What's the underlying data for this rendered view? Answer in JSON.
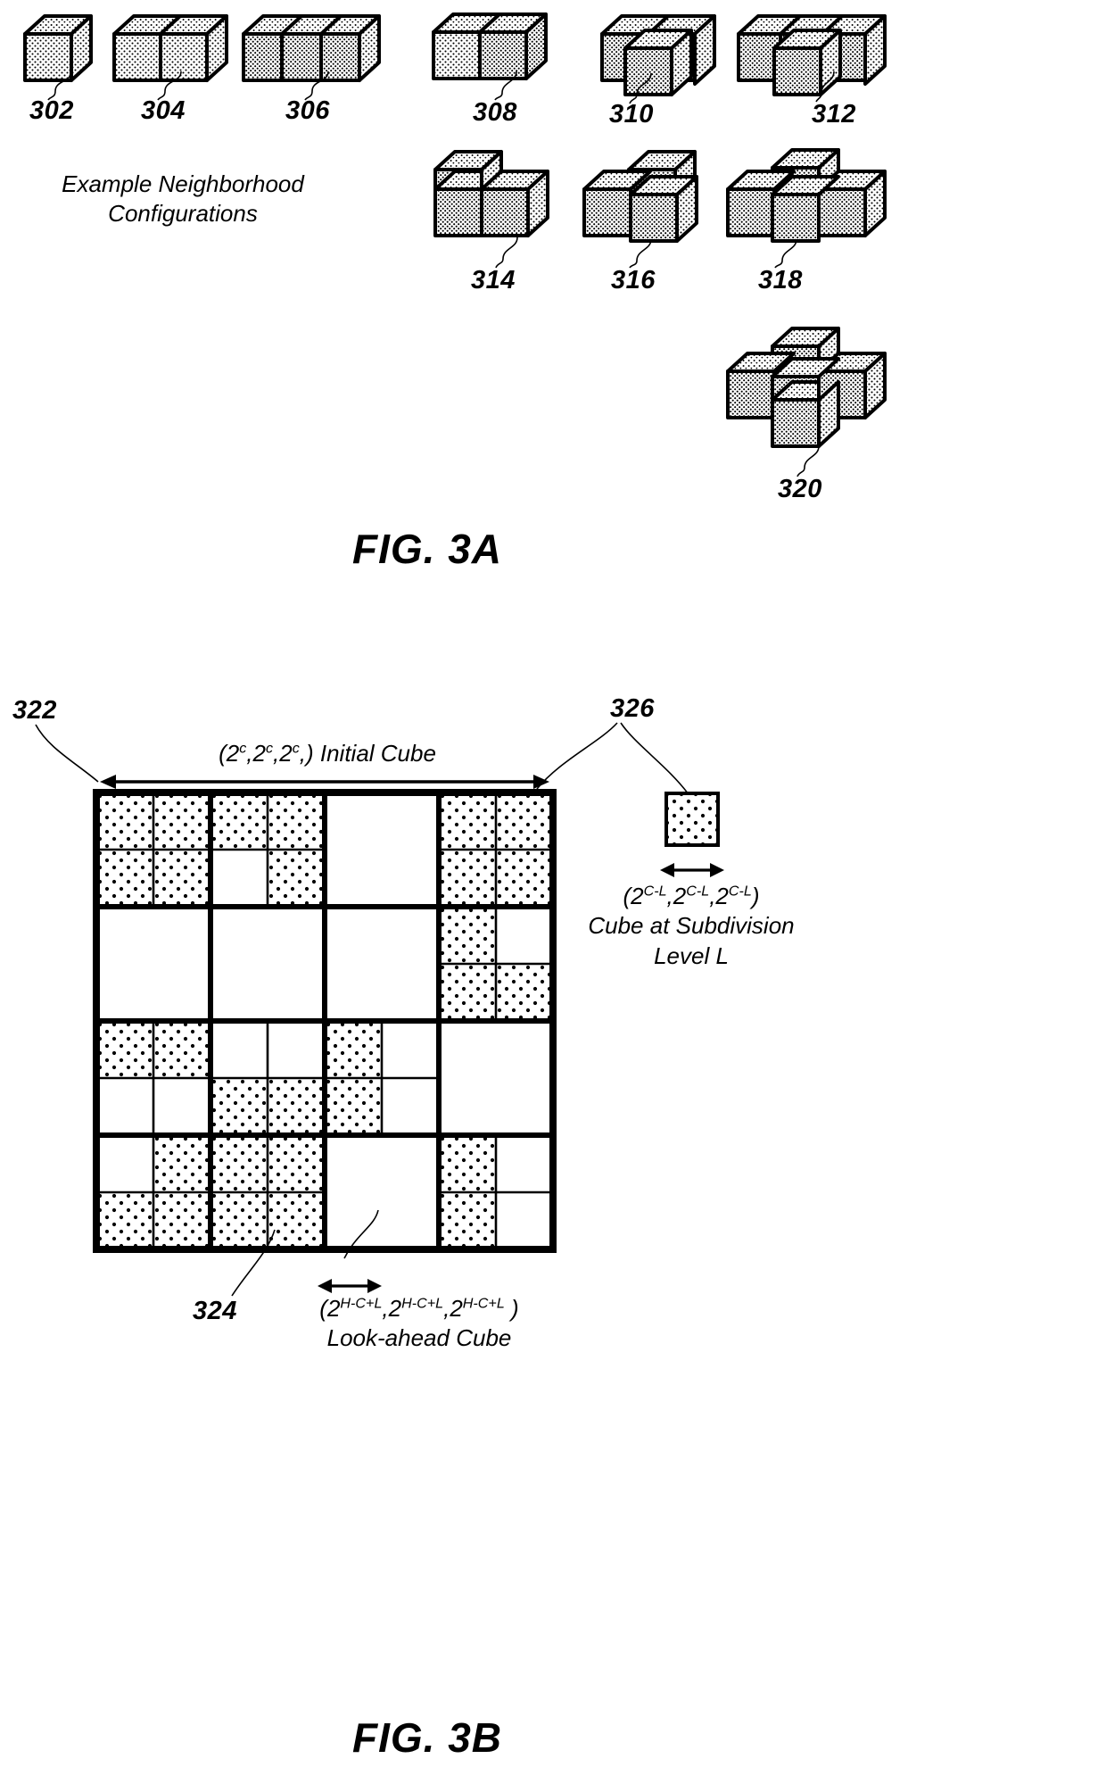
{
  "figures": [
    {
      "id": "fig3a",
      "label": "FIG. 3A",
      "caption": [
        "Example Neighborhood",
        "Configurations"
      ],
      "items": [
        {
          "ref": "302",
          "cubes": [
            [
              0,
              0,
              0
            ]
          ]
        },
        {
          "ref": "304",
          "cubes": [
            [
              0,
              0,
              0
            ],
            [
              1,
              0,
              0
            ]
          ]
        },
        {
          "ref": "306",
          "cubes": [
            [
              0,
              0,
              0
            ],
            [
              1,
              0,
              0
            ],
            [
              2,
              0,
              0
            ]
          ]
        },
        {
          "ref": "308",
          "cubes": [
            [
              0,
              0,
              0
            ],
            [
              1,
              0,
              0
            ],
            [
              0,
              1,
              0
            ]
          ]
        },
        {
          "ref": "310",
          "cubes": [
            [
              0,
              0,
              0
            ],
            [
              1,
              0,
              0
            ],
            [
              0,
              1,
              0
            ],
            [
              1,
              1,
              0
            ]
          ]
        },
        {
          "ref": "312",
          "cubes": [
            [
              0,
              0,
              0
            ],
            [
              1,
              0,
              0
            ],
            [
              2,
              0,
              0
            ],
            [
              1,
              1,
              0
            ]
          ]
        },
        {
          "ref": "314",
          "cubes": [
            [
              0,
              0,
              0
            ],
            [
              1,
              0,
              0
            ],
            [
              0,
              0,
              1
            ]
          ]
        },
        {
          "ref": "316",
          "cubes": [
            [
              0,
              0,
              0
            ],
            [
              1,
              0,
              0
            ],
            [
              0,
              1,
              0
            ],
            [
              0,
              0,
              1
            ]
          ]
        },
        {
          "ref": "318",
          "cubes": [
            [
              0,
              0,
              0
            ],
            [
              1,
              0,
              0
            ],
            [
              0,
              1,
              0
            ],
            [
              1,
              1,
              0
            ],
            [
              0,
              0,
              1
            ]
          ]
        },
        {
          "ref": "320",
          "cubes": [
            [
              0,
              0,
              0
            ],
            [
              1,
              0,
              0
            ],
            [
              0,
              1,
              0
            ],
            [
              1,
              1,
              0
            ],
            [
              2,
              0,
              0
            ],
            [
              0,
              0,
              1
            ]
          ]
        }
      ]
    },
    {
      "id": "fig3b",
      "label": "FIG. 3B",
      "refs": {
        "initial_cube": "322",
        "lookahead_cube": "324",
        "subdivision_cube": "326"
      },
      "annotations": {
        "top_dimension": {
          "prefix": "(2",
          "exp": "c",
          "text": ",2",
          "text2": ",2",
          "suffix": ",) Initial Cube",
          "full": "(2c,2c,2c,) Initial Cube"
        },
        "right_dimension": {
          "line1": "(2C-L,2C-L,2C-L)",
          "line2": "Cube at Subdivision",
          "line3": "Level L"
        },
        "bottom_dimension": {
          "line1": "(2H-C+L,2H-C+L,2H-C+L)",
          "line2": "Look-ahead Cube"
        }
      },
      "grid": {
        "cols": 8,
        "rows": 8,
        "filled": [
          [
            0,
            0
          ],
          [
            1,
            0
          ],
          [
            2,
            0
          ],
          [
            3,
            0
          ],
          [
            6,
            0
          ],
          [
            7,
            0
          ],
          [
            0,
            1
          ],
          [
            1,
            1
          ],
          [
            3,
            1
          ],
          [
            6,
            1
          ],
          [
            7,
            1
          ],
          [
            6,
            2
          ],
          [
            6,
            3
          ],
          [
            7,
            3
          ],
          [
            0,
            4
          ],
          [
            1,
            4
          ],
          [
            4,
            4
          ],
          [
            2,
            5
          ],
          [
            3,
            5
          ],
          [
            4,
            5
          ],
          [
            1,
            6
          ],
          [
            2,
            6
          ],
          [
            3,
            6
          ],
          [
            6,
            6
          ],
          [
            0,
            7
          ],
          [
            1,
            7
          ],
          [
            2,
            7
          ],
          [
            3,
            7
          ],
          [
            6,
            7
          ]
        ],
        "heavy_lines": {
          "vertical": [
            0,
            2,
            4,
            6,
            8
          ],
          "horizontal": [
            0,
            2,
            4,
            6,
            8
          ]
        }
      }
    }
  ],
  "colors": {
    "ink": "#000000",
    "fill_stipple": "#000000",
    "background": "#ffffff",
    "cube_top": "#ffffff",
    "cube_front": "#ffffff",
    "cube_side": "#ffffff"
  }
}
